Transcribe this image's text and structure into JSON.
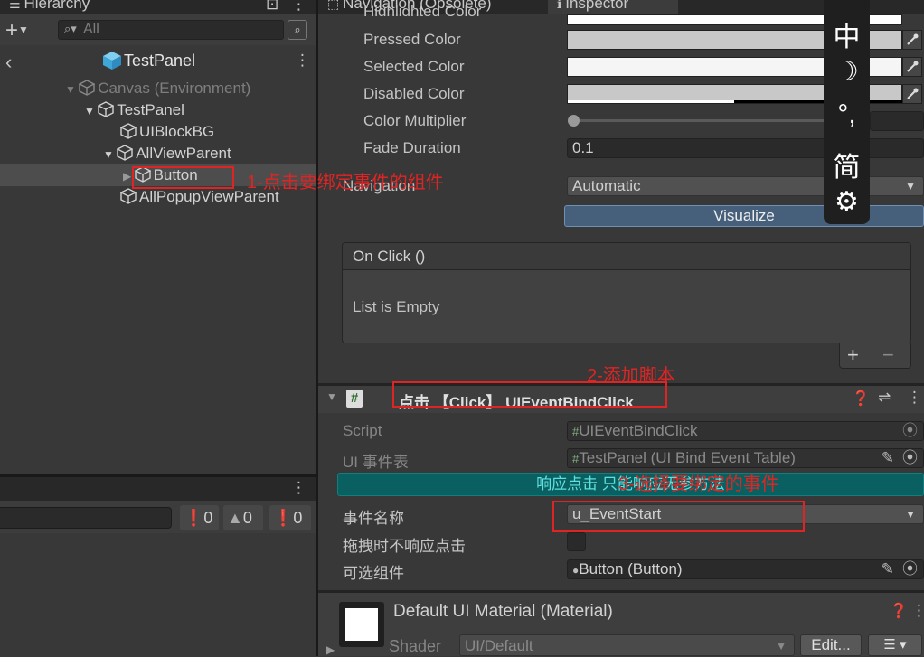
{
  "hierarchy": {
    "tab_title": "Hierarchy",
    "search_placeholder": "All",
    "scene_title": "TestPanel",
    "items": [
      {
        "label": "Canvas (Environment)"
      },
      {
        "label": "TestPanel"
      },
      {
        "label": "UIBlockBG"
      },
      {
        "label": "AllViewParent"
      },
      {
        "label": "Button"
      },
      {
        "label": "AllPopupViewParent"
      }
    ]
  },
  "console": {
    "info_count": "0",
    "warn_count": "0",
    "error_count": "0"
  },
  "tabs": {
    "navigation": "Navigation (Obsolete)",
    "inspector": "Inspector"
  },
  "button_props": {
    "highlighted_label": "Highlighted Color",
    "pressed_label": "Pressed Color",
    "selected_label": "Selected Color",
    "disabled_label": "Disabled Color",
    "multiplier_label": "Color Multiplier",
    "fade_label": "Fade Duration",
    "fade_value": "0.1",
    "navigation_label": "Navigation",
    "navigation_value": "Automatic",
    "visualize_label": "Visualize"
  },
  "onclick": {
    "header": "On Click ()",
    "empty_text": "List is Empty",
    "add": "+",
    "remove": "−"
  },
  "component": {
    "title": "点击 【Click】 UIEventBindClick",
    "script_label": "Script",
    "script_value": "UIEventBindClick",
    "table_label": "UI 事件表",
    "table_value": "TestPanel (UI Bind Event Table)",
    "banner_text": "响应点击 只能响应无参方法",
    "event_name_label": "事件名称",
    "event_name_value": "u_EventStart",
    "drag_label": "拖拽时不响应点击",
    "selectable_label": "可选组件",
    "selectable_value": "Button (Button)"
  },
  "material": {
    "title": "Default UI Material (Material)",
    "shader_label": "Shader",
    "shader_value": "UI/Default",
    "edit_label": "Edit..."
  },
  "annotations": {
    "step1": "1-点击要绑定事件的组件",
    "step2": "2-添加脚本",
    "step3": "3-选择要绑定的事件"
  },
  "ime": {
    "lang": "中",
    "punct": "°,",
    "simplified": "简"
  },
  "colors": {
    "accent_teal": "#0a6060",
    "visualize_blue": "#46607c",
    "annotation_red": "#e02424",
    "selection": "#4d4d4d"
  }
}
